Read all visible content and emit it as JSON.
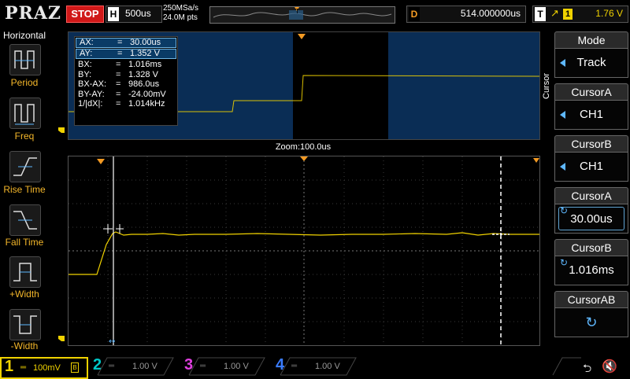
{
  "topbar": {
    "logo": "PRAZ",
    "run_state": "STOP",
    "horizontal_key": "H",
    "timebase": "500us",
    "sample_rate": "250MSa/s",
    "memory_depth": "24.0M pts",
    "delay_key": "D",
    "delay_value": "514.000000us",
    "trigger_key": "T",
    "trigger_channel": "1",
    "trigger_level": "1.76 V"
  },
  "left_panel": {
    "title": "Horizontal",
    "items": [
      {
        "label": "Period",
        "icon": "period-icon"
      },
      {
        "label": "Freq",
        "icon": "frequency-icon"
      },
      {
        "label": "Rise Time",
        "icon": "rise-time-icon"
      },
      {
        "label": "Fall Time",
        "icon": "fall-time-icon"
      },
      {
        "label": "+Width",
        "icon": "positive-width-icon"
      },
      {
        "label": "-Width",
        "icon": "negative-width-icon"
      }
    ]
  },
  "measurements": [
    {
      "name": "AX:",
      "value": "30.00us",
      "highlight": true
    },
    {
      "name": "AY:",
      "value": "1.352 V",
      "highlight": true
    },
    {
      "name": "BX:",
      "value": "1.016ms",
      "highlight": false
    },
    {
      "name": "BY:",
      "value": "1.328 V",
      "highlight": false
    },
    {
      "name": "BX-AX:",
      "value": "986.0us",
      "highlight": false
    },
    {
      "name": "BY-AY:",
      "value": "-24.00mV",
      "highlight": false
    },
    {
      "name": "1/|dX|:",
      "value": "1.014kHz",
      "highlight": false
    }
  ],
  "zoom_label": "Zoom:100.0us",
  "right_panel": {
    "side_label": "Cursor",
    "items": [
      {
        "head": "Mode",
        "value": "Track",
        "type": "select"
      },
      {
        "head": "CursorA",
        "value": "CH1",
        "type": "select"
      },
      {
        "head": "CursorB",
        "value": "CH1",
        "type": "select"
      },
      {
        "head": "CursorA",
        "value": "30.00us",
        "type": "knob"
      },
      {
        "head": "CursorB",
        "value": "1.016ms",
        "type": "knob"
      },
      {
        "head": "CursorAB",
        "value": "",
        "type": "knob"
      }
    ]
  },
  "channels": [
    {
      "num": "1",
      "scale": "100mV",
      "active": true,
      "color": "#f0d200"
    },
    {
      "num": "2",
      "scale": "1.00 V",
      "active": false,
      "color": "#00c8c8"
    },
    {
      "num": "3",
      "scale": "1.00 V",
      "active": false,
      "color": "#e040e0"
    },
    {
      "num": "4",
      "scale": "1.00 V",
      "active": false,
      "color": "#3a7cff"
    }
  ],
  "colors": {
    "ch1": "#f0d200",
    "trigger_marker": "#f39a23",
    "cursor_a": "#ffffff",
    "cursor_b": "#ffffff",
    "zoom_background": "#0a2d55"
  }
}
